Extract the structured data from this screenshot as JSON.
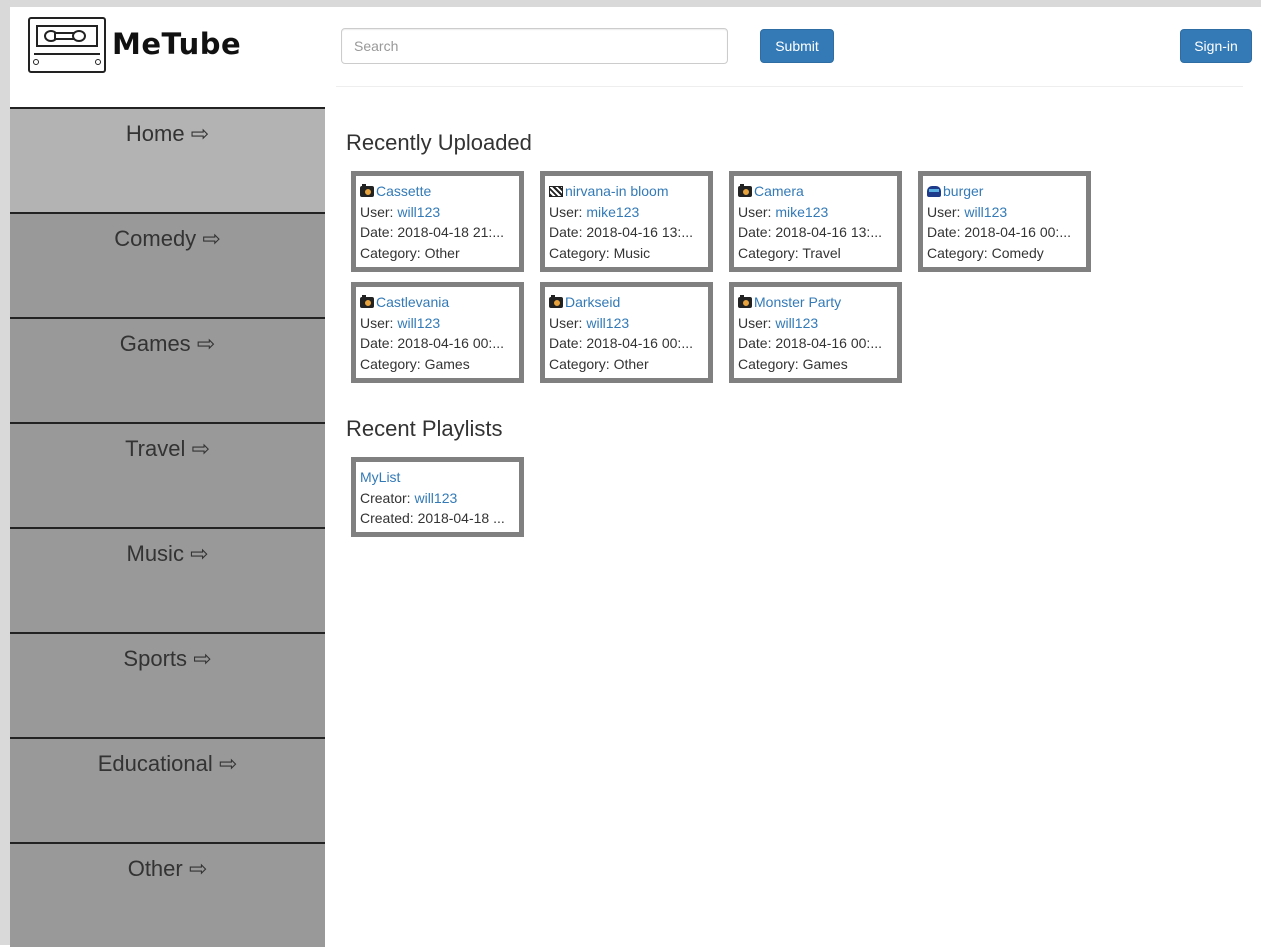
{
  "app": {
    "name": "MeTube"
  },
  "header": {
    "search_placeholder": "Search",
    "submit_label": "Submit",
    "signin_label": "Sign-in"
  },
  "sidebar": {
    "items": [
      {
        "label": "Home ⇨",
        "active": true
      },
      {
        "label": "Comedy ⇨"
      },
      {
        "label": "Games ⇨"
      },
      {
        "label": "Travel ⇨"
      },
      {
        "label": "Music ⇨"
      },
      {
        "label": "Sports ⇨"
      },
      {
        "label": "Educational ⇨"
      },
      {
        "label": "Other ⇨"
      }
    ]
  },
  "recent": {
    "title": "Recently Uploaded",
    "user_prefix": "User: ",
    "date_prefix": "Date: ",
    "category_prefix": "Category: ",
    "items": [
      {
        "icon": "camera-icon",
        "title": "Cassette",
        "user": "will123",
        "date": "2018-04-18 21:",
        "category": "Other"
      },
      {
        "icon": "clapperboard-icon",
        "title": "nirvana-in bloom",
        "user": "mike123",
        "date": "2018-04-16 13:",
        "category": "Music"
      },
      {
        "icon": "camera-icon",
        "title": "Camera",
        "user": "mike123",
        "date": "2018-04-16 13:",
        "category": "Travel"
      },
      {
        "icon": "burger-icon",
        "title": "burger",
        "user": "will123",
        "date": "2018-04-16 00:",
        "category": "Comedy"
      },
      {
        "icon": "camera-icon",
        "title": "Castlevania",
        "user": "will123",
        "date": "2018-04-16 00:",
        "category": "Games"
      },
      {
        "icon": "camera-icon",
        "title": "Darkseid",
        "user": "will123",
        "date": "2018-04-16 00:",
        "category": "Other"
      },
      {
        "icon": "camera-icon",
        "title": "Monster Party",
        "user": "will123",
        "date": "2018-04-16 00:",
        "category": "Games"
      }
    ]
  },
  "playlists": {
    "title": "Recent Playlists",
    "creator_prefix": "Creator: ",
    "created_prefix": "Created: ",
    "items": [
      {
        "name": "MyList",
        "creator": "will123",
        "created": "2018-04-18 ..."
      }
    ]
  },
  "colors": {
    "link": "#337ab7",
    "button": "#337ab7",
    "sidebar": "#999999",
    "sidebar_active": "#b3b3b3",
    "card_border": "#808080"
  }
}
